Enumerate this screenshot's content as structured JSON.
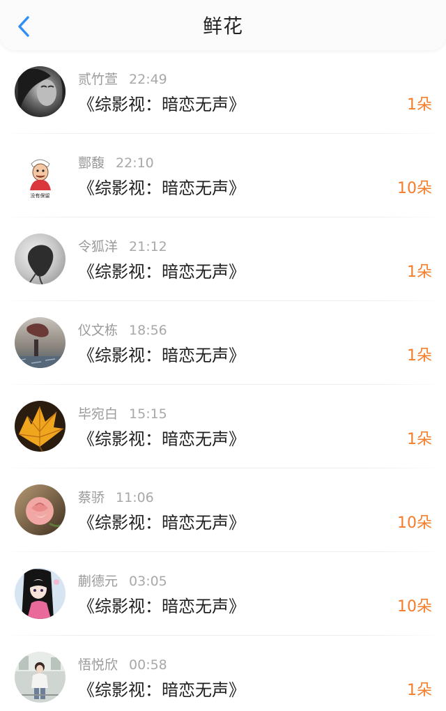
{
  "header": {
    "title": "鲜花",
    "back_icon": "chevron-left-icon",
    "accent_color": "#2f8ff5"
  },
  "list": {
    "items": [
      {
        "username": "贰竹萱",
        "time": "22:49",
        "book": "《综影视：暗恋无声》",
        "count": "1朵",
        "avatar": "bw-portrait"
      },
      {
        "username": "酆馥",
        "time": "22:10",
        "book": "《综影视：暗恋无声》",
        "count": "10朵",
        "avatar": "cartoon-meme",
        "avatar_caption": "没有保留"
      },
      {
        "username": "令狐洋",
        "time": "21:12",
        "book": "《综影视：暗恋无声》",
        "count": "1朵",
        "avatar": "grey-hair-portrait"
      },
      {
        "username": "仪文栋",
        "time": "18:56",
        "book": "《综影视：暗恋无声》",
        "count": "1朵",
        "avatar": "rainy-scene"
      },
      {
        "username": "毕宛白",
        "time": "15:15",
        "book": "《综影视：暗恋无声》",
        "count": "1朵",
        "avatar": "autumn-leaf"
      },
      {
        "username": "蔡骄",
        "time": "11:06",
        "book": "《综影视：暗恋无声》",
        "count": "10朵",
        "avatar": "pink-rose"
      },
      {
        "username": "蒯德元",
        "time": "03:05",
        "book": "《综影视：暗恋无声》",
        "count": "10朵",
        "avatar": "anime-girl"
      },
      {
        "username": "悟悦欣",
        "time": "00:58",
        "book": "《综影视：暗恋无声》",
        "count": "1朵",
        "avatar": "girl-photo"
      }
    ]
  },
  "colors": {
    "count": "#f47b2a",
    "meta": "#9a9a9a",
    "title": "#222222"
  }
}
